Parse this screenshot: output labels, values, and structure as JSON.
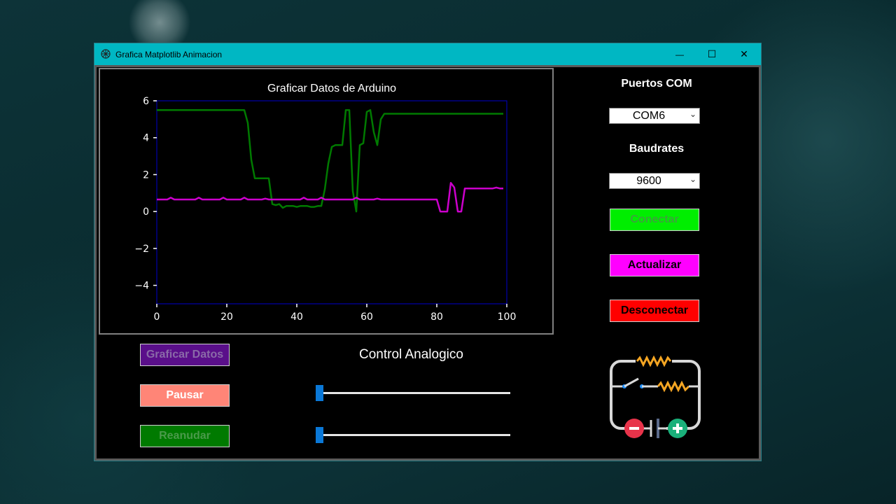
{
  "window": {
    "title": "Grafica Matplotlib Animacion",
    "minimize_label": "—",
    "maximize_label": "☐",
    "close_label": "✕"
  },
  "chart_data": {
    "type": "line",
    "title": "Graficar Datos de Arduino",
    "xlabel": "",
    "ylabel": "",
    "xlim": [
      0,
      100
    ],
    "ylim": [
      -5,
      6
    ],
    "x_ticks": [
      0,
      20,
      40,
      60,
      80,
      100
    ],
    "y_ticks": [
      6,
      4,
      2,
      0,
      -2,
      -4
    ],
    "y_tick_labels": [
      "6",
      "4",
      "2",
      "0",
      "−2",
      "−4"
    ],
    "grid": false,
    "series": [
      {
        "color": "#007a00",
        "x": [
          0,
          1,
          2,
          3,
          4,
          5,
          6,
          7,
          8,
          9,
          10,
          11,
          12,
          13,
          14,
          15,
          16,
          17,
          18,
          19,
          20,
          21,
          22,
          23,
          24,
          25,
          26,
          27,
          28,
          29,
          30,
          31,
          32,
          33,
          34,
          35,
          36,
          37,
          38,
          39,
          40,
          41,
          42,
          43,
          44,
          45,
          46,
          47,
          48,
          49,
          50,
          51,
          52,
          53,
          54,
          55,
          56,
          57,
          58,
          59,
          60,
          61,
          62,
          63,
          64,
          65,
          66,
          67,
          68,
          69,
          70,
          71,
          72,
          73,
          74,
          75,
          76,
          77,
          78,
          79,
          80,
          81,
          82,
          83,
          84,
          85,
          86,
          87,
          88,
          89,
          90,
          91,
          92,
          93,
          94,
          95,
          96,
          97,
          98,
          99
        ],
        "y": [
          5.5,
          5.5,
          5.5,
          5.5,
          5.5,
          5.5,
          5.5,
          5.5,
          5.5,
          5.5,
          5.5,
          5.5,
          5.5,
          5.5,
          5.5,
          5.5,
          5.5,
          5.5,
          5.5,
          5.5,
          5.5,
          5.5,
          5.5,
          5.5,
          5.5,
          5.5,
          4.8,
          2.8,
          1.8,
          1.8,
          1.8,
          1.8,
          1.8,
          0.4,
          0.35,
          0.4,
          0.2,
          0.3,
          0.3,
          0.3,
          0.25,
          0.3,
          0.3,
          0.3,
          0.25,
          0.25,
          0.3,
          0.3,
          1.2,
          2.6,
          3.5,
          3.6,
          3.6,
          3.6,
          5.5,
          5.5,
          1.1,
          0.0,
          3.6,
          3.7,
          5.4,
          5.5,
          4.3,
          3.6,
          5.0,
          5.3,
          5.3,
          5.3,
          5.3,
          5.3,
          5.3,
          5.3,
          5.3,
          5.3,
          5.3,
          5.3,
          5.3,
          5.3,
          5.3,
          5.3,
          5.3,
          5.3,
          5.3,
          5.3,
          5.3,
          5.3,
          5.3,
          5.3,
          5.3,
          5.3,
          5.3,
          5.3,
          5.3,
          5.3,
          5.3,
          5.3,
          5.3,
          5.3,
          5.3,
          5.3
        ]
      },
      {
        "color": "#cc00cc",
        "x": [
          0,
          1,
          2,
          3,
          4,
          5,
          6,
          7,
          8,
          9,
          10,
          11,
          12,
          13,
          14,
          15,
          16,
          17,
          18,
          19,
          20,
          21,
          22,
          23,
          24,
          25,
          26,
          27,
          28,
          29,
          30,
          31,
          32,
          33,
          34,
          35,
          36,
          37,
          38,
          39,
          40,
          41,
          42,
          43,
          44,
          45,
          46,
          47,
          48,
          49,
          50,
          51,
          52,
          53,
          54,
          55,
          56,
          57,
          58,
          59,
          60,
          61,
          62,
          63,
          64,
          65,
          66,
          67,
          68,
          69,
          70,
          71,
          72,
          73,
          74,
          75,
          76,
          77,
          78,
          79,
          80,
          81,
          82,
          83,
          84,
          85,
          86,
          87,
          88,
          89,
          90,
          91,
          92,
          93,
          94,
          95,
          96,
          97,
          98,
          99
        ],
        "y": [
          0.65,
          0.65,
          0.65,
          0.65,
          0.75,
          0.65,
          0.65,
          0.65,
          0.65,
          0.65,
          0.65,
          0.65,
          0.75,
          0.65,
          0.65,
          0.65,
          0.65,
          0.65,
          0.65,
          0.75,
          0.65,
          0.65,
          0.65,
          0.65,
          0.65,
          0.75,
          0.65,
          0.65,
          0.65,
          0.65,
          0.65,
          0.7,
          0.65,
          0.65,
          0.65,
          0.65,
          0.65,
          0.65,
          0.65,
          0.65,
          0.65,
          0.65,
          0.75,
          0.65,
          0.65,
          0.65,
          0.65,
          0.75,
          0.65,
          0.65,
          0.65,
          0.65,
          0.65,
          0.65,
          0.65,
          0.65,
          0.65,
          0.75,
          0.65,
          0.65,
          0.65,
          0.65,
          0.65,
          0.7,
          0.65,
          0.65,
          0.65,
          0.65,
          0.65,
          0.65,
          0.65,
          0.65,
          0.65,
          0.65,
          0.65,
          0.65,
          0.65,
          0.65,
          0.65,
          0.65,
          0.65,
          0.0,
          0.0,
          0.0,
          1.55,
          1.3,
          0.0,
          0.0,
          1.25,
          1.25,
          1.25,
          1.25,
          1.25,
          1.25,
          1.25,
          1.25,
          1.25,
          1.3,
          1.25,
          1.25
        ]
      }
    ]
  },
  "right_panel": {
    "ports_label": "Puertos COM",
    "port_selected": "COM6",
    "baud_label": "Baudrates",
    "baud_selected": "9600",
    "connect_label": "Conectar",
    "refresh_label": "Actualizar",
    "disconnect_label": "Desconectar",
    "colors": {
      "connect": "#00ee00",
      "refresh": "#ff00ff",
      "disconnect": "#ff0000"
    }
  },
  "bottom_panel": {
    "plot_button_label": "Graficar Datos",
    "pause_button_label": "Pausar",
    "resume_button_label": "Reanudar",
    "control_title": "Control Analogico",
    "slider1_value": 0,
    "slider2_value": 0,
    "colors": {
      "plot": "#5a0f8a",
      "pause": "#ff8577",
      "resume": "#007a00"
    }
  }
}
